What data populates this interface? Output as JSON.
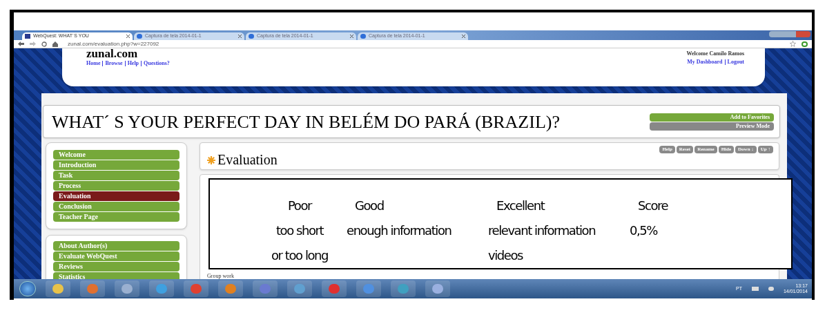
{
  "browser": {
    "tabs": [
      {
        "label": "WebQuest: WHAT´S YOU",
        "selected": true
      },
      {
        "label": "Captura de tela 2014-01-1",
        "selected": false
      },
      {
        "label": "Captura de tela 2014-01-1",
        "selected": false
      },
      {
        "label": "Captura de tela 2014-01-1",
        "selected": false
      }
    ],
    "address": "zunal.com/evaluation.php?w=227092"
  },
  "header": {
    "logo": "zunal.com",
    "nav_links": [
      "Home",
      "Browse",
      "Help",
      "Questions?"
    ],
    "welcome": "Welcome Camilo Ramos",
    "user_links": [
      "My Dashboard",
      "Logout"
    ]
  },
  "title": "WHAT´ S YOUR PERFECT DAY IN BELÉM DO PARÁ (BRAZIL)?",
  "title_buttons": [
    {
      "label": "Add to Favorites",
      "kind": "green"
    },
    {
      "label": "Preview Mode",
      "kind": "gray"
    }
  ],
  "sidebar": {
    "menu": [
      {
        "label": "Welcome",
        "selected": false
      },
      {
        "label": "Introduction",
        "selected": false
      },
      {
        "label": "Task",
        "selected": false
      },
      {
        "label": "Process",
        "selected": false
      },
      {
        "label": "Evaluation",
        "selected": true
      },
      {
        "label": "Conclusion",
        "selected": false
      },
      {
        "label": "Teacher Page",
        "selected": false
      }
    ],
    "extras": [
      {
        "label": "About Author(s)",
        "selected": false
      },
      {
        "label": "Evaluate WebQuest",
        "selected": false
      },
      {
        "label": "Reviews",
        "selected": false
      },
      {
        "label": "Statistics",
        "selected": false
      }
    ]
  },
  "section": {
    "title": "Evaluation",
    "tools": [
      "Help",
      "Reset",
      "Rename",
      "Hide",
      "Down ↓",
      "Up ↑"
    ],
    "footer_text": "Group work"
  },
  "overlay": {
    "columns": [
      {
        "heading": "Poor",
        "lines": [
          "too short",
          "or too long"
        ]
      },
      {
        "heading": "Good",
        "lines": [
          "enough information"
        ]
      },
      {
        "heading": "Excellent",
        "lines": [
          "relevant information",
          "videos"
        ]
      },
      {
        "heading": "Score",
        "lines": [
          "0,5%"
        ]
      }
    ]
  },
  "taskbar": {
    "language": "PT",
    "time": "13:17",
    "date": "14/01/2014"
  }
}
